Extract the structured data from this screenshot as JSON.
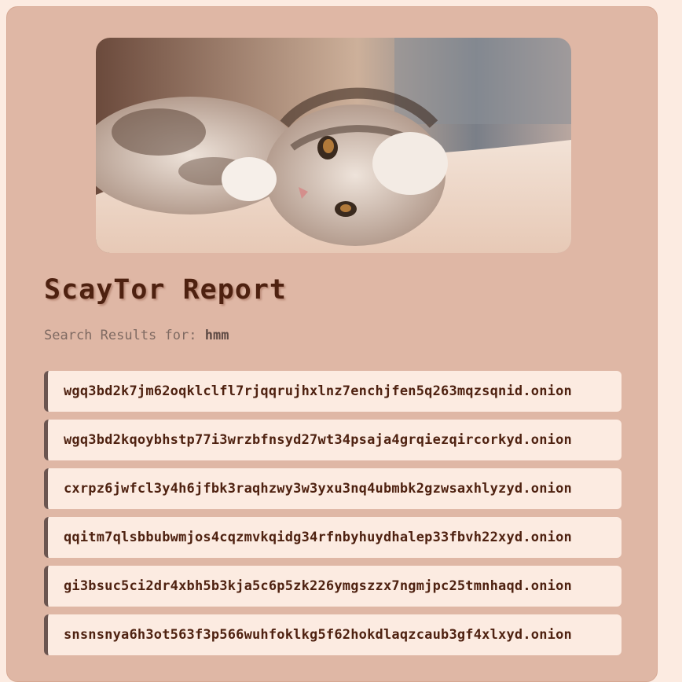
{
  "header": {
    "image": {
      "alt": "kitten-photo"
    },
    "title": "ScayTor Report"
  },
  "search": {
    "label": "Search Results for:",
    "query": "hmm"
  },
  "results": [
    "wgq3bd2k7jm62oqklclfl7rjqqrujhxlnz7enchjfen5q263mqzsqnid.onion",
    "wgq3bd2kqoybhstp77i3wrzbfnsyd27wt34psaja4grqiezqircorkyd.onion",
    "cxrpz6jwfcl3y4h6jfbk3raqhzwy3w3yxu3nq4ubmbk2gzwsaxhlyzyd.onion",
    "qqitm7qlsbbubwmjos4cqzmvkqidg34rfnbyhuydhalep33fbvh22xyd.onion",
    "gi3bsuc5ci2dr4xbh5b3kja5c6p5zk226ymgszzx7ngmjpc25tmnhaqd.onion",
    "snsnsnya6h3ot563f3p566wuhfoklkg5f62hokdlaqzcaub3gf4xlxyd.onion"
  ],
  "colors": {
    "page_bg": "#fcebe1",
    "panel_bg": "#dfb7a5",
    "title": "#4e2110",
    "result_bg": "#fcebe1",
    "result_border": "#6b5550"
  }
}
